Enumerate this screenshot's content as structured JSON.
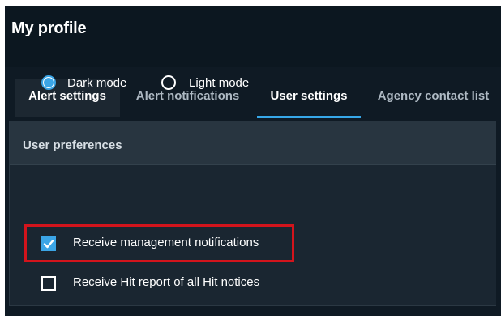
{
  "header": {
    "title": "My profile"
  },
  "tabs": [
    {
      "label": "Alert settings"
    },
    {
      "label": "Alert notifications"
    },
    {
      "label": "User settings"
    },
    {
      "label": "Agency contact list"
    }
  ],
  "card": {
    "title": "User preferences",
    "theme_options": [
      {
        "label": "Dark mode",
        "checked": true
      },
      {
        "label": "Light mode",
        "checked": false
      }
    ],
    "checkboxes": [
      {
        "label": "Receive management notifications",
        "checked": true
      },
      {
        "label": "Receive Hit report of all Hit notices",
        "checked": false
      }
    ]
  },
  "colors": {
    "accent": "#3ba5e6",
    "highlight": "#d3141c",
    "background": "#0f1a24"
  }
}
